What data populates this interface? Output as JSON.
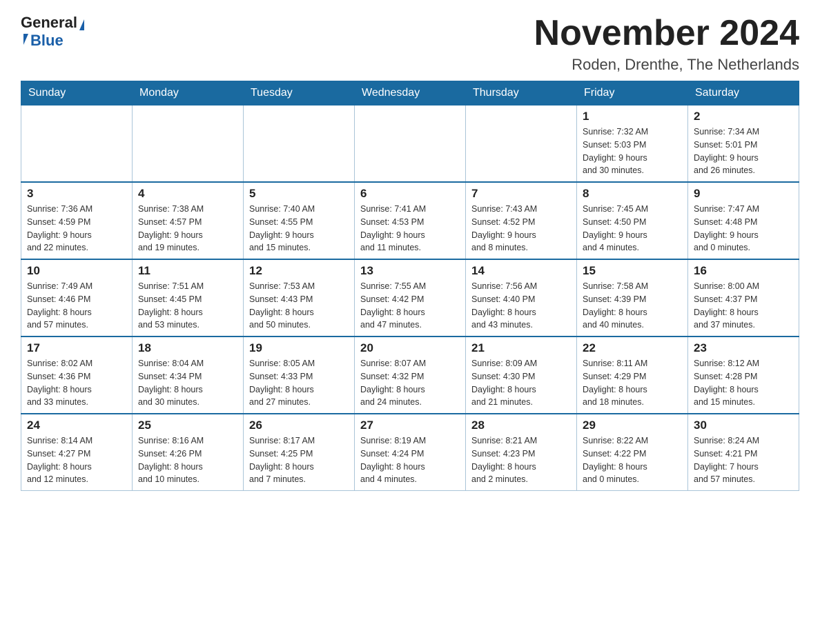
{
  "header": {
    "logo": {
      "general": "General",
      "blue": "Blue",
      "alt": "GeneralBlue logo"
    },
    "title": "November 2024",
    "subtitle": "Roden, Drenthe, The Netherlands"
  },
  "weekdays": [
    "Sunday",
    "Monday",
    "Tuesday",
    "Wednesday",
    "Thursday",
    "Friday",
    "Saturday"
  ],
  "weeks": [
    [
      {
        "day": "",
        "info": ""
      },
      {
        "day": "",
        "info": ""
      },
      {
        "day": "",
        "info": ""
      },
      {
        "day": "",
        "info": ""
      },
      {
        "day": "",
        "info": ""
      },
      {
        "day": "1",
        "info": "Sunrise: 7:32 AM\nSunset: 5:03 PM\nDaylight: 9 hours\nand 30 minutes."
      },
      {
        "day": "2",
        "info": "Sunrise: 7:34 AM\nSunset: 5:01 PM\nDaylight: 9 hours\nand 26 minutes."
      }
    ],
    [
      {
        "day": "3",
        "info": "Sunrise: 7:36 AM\nSunset: 4:59 PM\nDaylight: 9 hours\nand 22 minutes."
      },
      {
        "day": "4",
        "info": "Sunrise: 7:38 AM\nSunset: 4:57 PM\nDaylight: 9 hours\nand 19 minutes."
      },
      {
        "day": "5",
        "info": "Sunrise: 7:40 AM\nSunset: 4:55 PM\nDaylight: 9 hours\nand 15 minutes."
      },
      {
        "day": "6",
        "info": "Sunrise: 7:41 AM\nSunset: 4:53 PM\nDaylight: 9 hours\nand 11 minutes."
      },
      {
        "day": "7",
        "info": "Sunrise: 7:43 AM\nSunset: 4:52 PM\nDaylight: 9 hours\nand 8 minutes."
      },
      {
        "day": "8",
        "info": "Sunrise: 7:45 AM\nSunset: 4:50 PM\nDaylight: 9 hours\nand 4 minutes."
      },
      {
        "day": "9",
        "info": "Sunrise: 7:47 AM\nSunset: 4:48 PM\nDaylight: 9 hours\nand 0 minutes."
      }
    ],
    [
      {
        "day": "10",
        "info": "Sunrise: 7:49 AM\nSunset: 4:46 PM\nDaylight: 8 hours\nand 57 minutes."
      },
      {
        "day": "11",
        "info": "Sunrise: 7:51 AM\nSunset: 4:45 PM\nDaylight: 8 hours\nand 53 minutes."
      },
      {
        "day": "12",
        "info": "Sunrise: 7:53 AM\nSunset: 4:43 PM\nDaylight: 8 hours\nand 50 minutes."
      },
      {
        "day": "13",
        "info": "Sunrise: 7:55 AM\nSunset: 4:42 PM\nDaylight: 8 hours\nand 47 minutes."
      },
      {
        "day": "14",
        "info": "Sunrise: 7:56 AM\nSunset: 4:40 PM\nDaylight: 8 hours\nand 43 minutes."
      },
      {
        "day": "15",
        "info": "Sunrise: 7:58 AM\nSunset: 4:39 PM\nDaylight: 8 hours\nand 40 minutes."
      },
      {
        "day": "16",
        "info": "Sunrise: 8:00 AM\nSunset: 4:37 PM\nDaylight: 8 hours\nand 37 minutes."
      }
    ],
    [
      {
        "day": "17",
        "info": "Sunrise: 8:02 AM\nSunset: 4:36 PM\nDaylight: 8 hours\nand 33 minutes."
      },
      {
        "day": "18",
        "info": "Sunrise: 8:04 AM\nSunset: 4:34 PM\nDaylight: 8 hours\nand 30 minutes."
      },
      {
        "day": "19",
        "info": "Sunrise: 8:05 AM\nSunset: 4:33 PM\nDaylight: 8 hours\nand 27 minutes."
      },
      {
        "day": "20",
        "info": "Sunrise: 8:07 AM\nSunset: 4:32 PM\nDaylight: 8 hours\nand 24 minutes."
      },
      {
        "day": "21",
        "info": "Sunrise: 8:09 AM\nSunset: 4:30 PM\nDaylight: 8 hours\nand 21 minutes."
      },
      {
        "day": "22",
        "info": "Sunrise: 8:11 AM\nSunset: 4:29 PM\nDaylight: 8 hours\nand 18 minutes."
      },
      {
        "day": "23",
        "info": "Sunrise: 8:12 AM\nSunset: 4:28 PM\nDaylight: 8 hours\nand 15 minutes."
      }
    ],
    [
      {
        "day": "24",
        "info": "Sunrise: 8:14 AM\nSunset: 4:27 PM\nDaylight: 8 hours\nand 12 minutes."
      },
      {
        "day": "25",
        "info": "Sunrise: 8:16 AM\nSunset: 4:26 PM\nDaylight: 8 hours\nand 10 minutes."
      },
      {
        "day": "26",
        "info": "Sunrise: 8:17 AM\nSunset: 4:25 PM\nDaylight: 8 hours\nand 7 minutes."
      },
      {
        "day": "27",
        "info": "Sunrise: 8:19 AM\nSunset: 4:24 PM\nDaylight: 8 hours\nand 4 minutes."
      },
      {
        "day": "28",
        "info": "Sunrise: 8:21 AM\nSunset: 4:23 PM\nDaylight: 8 hours\nand 2 minutes."
      },
      {
        "day": "29",
        "info": "Sunrise: 8:22 AM\nSunset: 4:22 PM\nDaylight: 8 hours\nand 0 minutes."
      },
      {
        "day": "30",
        "info": "Sunrise: 8:24 AM\nSunset: 4:21 PM\nDaylight: 7 hours\nand 57 minutes."
      }
    ]
  ]
}
